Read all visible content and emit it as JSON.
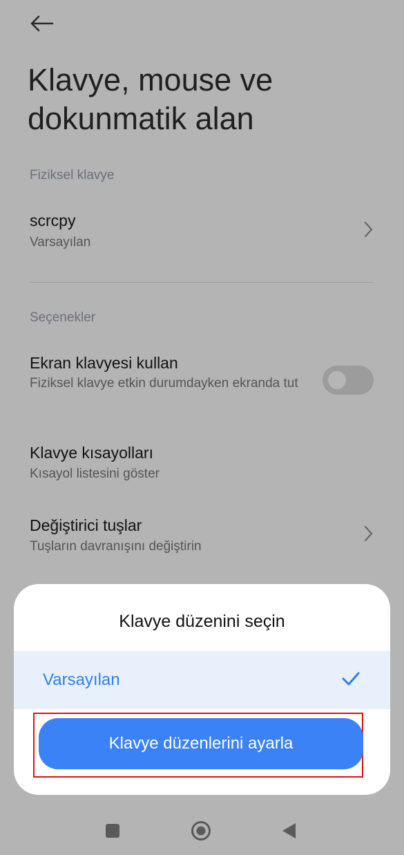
{
  "header": {
    "back_icon": "arrow-left-icon",
    "title": "Klavye, mouse ve dokunmatik alan"
  },
  "sections": {
    "physical_keyboard": "Fiziksel klavye",
    "options": "Seçenekler"
  },
  "physical_keyboard_item": {
    "title": "scrcpy",
    "subtitle": "Varsayılan"
  },
  "options_items": [
    {
      "title": "Ekran klavyesi kullan",
      "subtitle": "Fiziksel klavye etkin durumdayken ekranda tut",
      "toggle_on": false
    },
    {
      "title": "Klavye kısayolları",
      "subtitle": "Kısayol listesini göster"
    },
    {
      "title": "Değiştirici tuşlar",
      "subtitle": "Tuşların davranışını değiştirin"
    }
  ],
  "dialog": {
    "title": "Klavye düzenini seçin",
    "selected_option": "Varsayılan",
    "action_button": "Klavye düzenlerini ayarla"
  },
  "colors": {
    "accent": "#3b82f6",
    "selected_bg": "#e8f0fb",
    "highlight": "#e01010"
  }
}
